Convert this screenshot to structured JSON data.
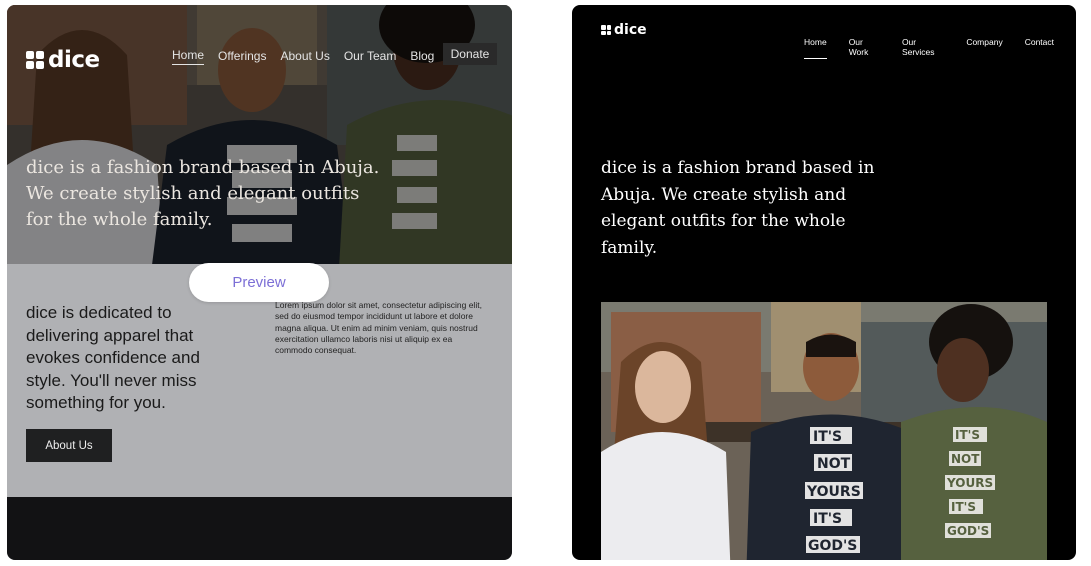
{
  "left_preview": {
    "logo_text": "dice",
    "nav": {
      "items": [
        {
          "label": "Home",
          "active": true
        },
        {
          "label": "Offerings"
        },
        {
          "label": "About Us"
        },
        {
          "label": "Our Team"
        },
        {
          "label": "Blog"
        }
      ],
      "donate_label": "Donate"
    },
    "hero_text": "dice is a fashion brand based in Abuja. We create stylish and elegant outfits for the whole family.",
    "preview_label": "Preview",
    "body_heading": "dice is dedicated to delivering apparel that evokes confidence and style. You'll never miss something for you.",
    "body_paragraph": "Lorem ipsum dolor sit amet, consectetur adipiscing elit, sed do eiusmod tempor incididunt ut labore et dolore magna aliqua. Ut enim ad minim veniam, quis nostrud exercitation ullamco laboris nisi ut aliquip ex ea commodo consequat.",
    "about_button_label": "About Us"
  },
  "right_preview": {
    "logo_text": "dice",
    "nav": {
      "items": [
        {
          "label": "Home",
          "active": true
        },
        {
          "label": "Our Work"
        },
        {
          "label": "Our Services"
        },
        {
          "label": "Company"
        },
        {
          "label": "Contact"
        }
      ]
    },
    "hero_text": "dice is a fashion brand based in Abuja. We create stylish and elegant outfits for the whole family."
  },
  "photo_shirt_text": [
    "IT'S",
    "NOT",
    "YOURS",
    "IT'S",
    "GOD'S"
  ],
  "colors": {
    "accent_preview": "#7c6fd6",
    "left_background": "#b0b1b4",
    "right_background": "#000000",
    "footer": "#121214"
  },
  "icons": [
    "dice-logo-icon"
  ]
}
